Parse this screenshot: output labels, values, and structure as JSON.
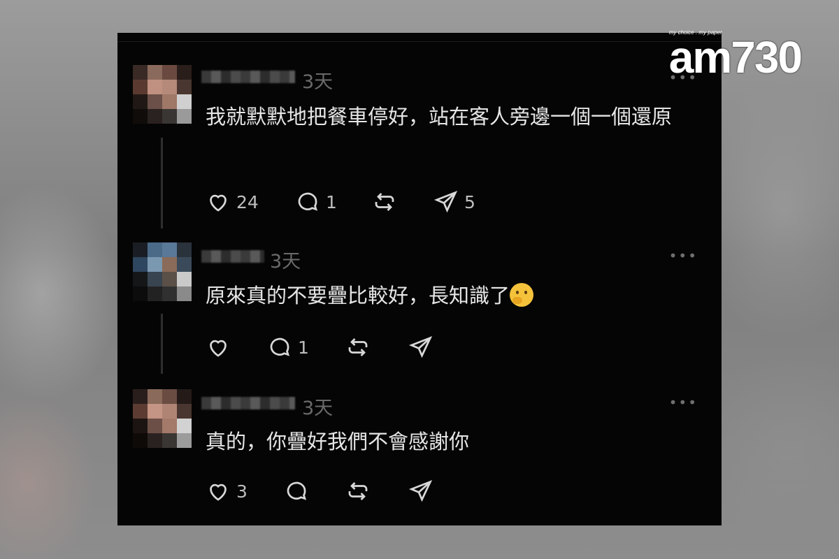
{
  "logo": {
    "tagline": "my choice . my paper",
    "brand": "am730"
  },
  "posts": [
    {
      "time": "3天",
      "more": "•••",
      "text": "我就默默地把餐車停好，站在客人旁邊一個一個還原",
      "likes": "24",
      "replies": "1",
      "reposts": "",
      "shares": "5"
    },
    {
      "time": "3天",
      "more": "•••",
      "text": "原來真的不要疊比較好，長知識了",
      "emoji": "thinking-face",
      "likes": "",
      "replies": "1",
      "reposts": "",
      "shares": ""
    },
    {
      "time": "3天",
      "more": "•••",
      "text": "真的，你疊好我們不會感謝你",
      "likes": "3",
      "replies": "",
      "reposts": "",
      "shares": ""
    }
  ],
  "icons": [
    "heart-icon",
    "comment-icon",
    "repost-icon",
    "share-icon",
    "more-icon"
  ]
}
